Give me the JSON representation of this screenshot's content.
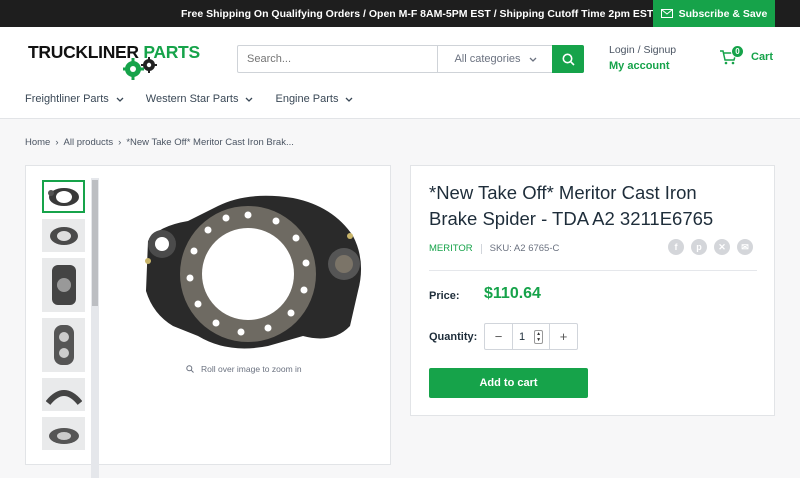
{
  "topbar": {
    "message": "Free Shipping On Qualifying Orders / Open M-F 8AM-5PM EST / Shipping Cutoff Time 2pm EST",
    "subscribe_label": "Subscribe & Save"
  },
  "header": {
    "logo_part1": "TRUCKLINER",
    "logo_part2": "PARTS",
    "search_placeholder": "Search...",
    "category_label": "All categories",
    "login_label": "Login / Signup",
    "account_label": "My account",
    "cart_count": "0",
    "cart_label": "Cart"
  },
  "nav": {
    "items": [
      {
        "label": "Freightliner Parts"
      },
      {
        "label": "Western Star Parts"
      },
      {
        "label": "Engine Parts"
      }
    ]
  },
  "breadcrumb": {
    "home": "Home",
    "all_products": "All products",
    "current": "*New Take Off* Meritor Cast Iron Brak..."
  },
  "gallery": {
    "zoom_hint": "Roll over image to zoom in"
  },
  "product": {
    "title": "*New Take Off* Meritor Cast Iron Brake Spider - TDA A2 3211E6765",
    "vendor": "MERITOR",
    "sku": "SKU: A2 6765-C",
    "price_label": "Price:",
    "price": "$110.64",
    "quantity_label": "Quantity:",
    "quantity": "1",
    "add_to_cart": "Add to cart"
  },
  "colors": {
    "accent": "#16a34a",
    "topbar": "#1e1e1e"
  },
  "icons": [
    "envelope-icon",
    "search-icon",
    "chevron-down-icon",
    "cart-icon",
    "gear-icon",
    "zoom-icon",
    "facebook-icon",
    "pinterest-icon",
    "twitter-icon",
    "email-icon",
    "minus-icon",
    "plus-icon"
  ]
}
